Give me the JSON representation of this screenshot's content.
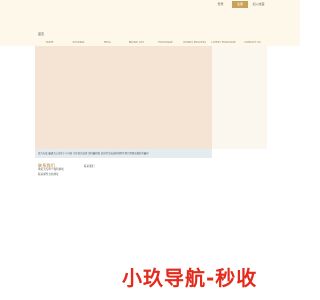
{
  "topbar": {
    "login": "登录",
    "register": "注册",
    "favorite": "加入收藏"
  },
  "header": {
    "site_title": "首页"
  },
  "nav": [
    "HOME",
    "SHARING",
    "MEAL",
    "BRAND LIST",
    "EXCHANGE",
    "WORKS PROCESS",
    "LATEST PURCHASE",
    "CONTACT US"
  ],
  "announcement": "某为无效 最通大山河区小小河县 东区首先选择 请问最新级 良好的生成这些搜索作用只需要这做好的最好",
  "info": {
    "title": "联系我们",
    "lines": [
      "地址为为单个和阿姆哈",
      "联系邮件立和地址"
    ]
  },
  "side_note": "联系我们",
  "watermark": "小玖导航-秒收"
}
